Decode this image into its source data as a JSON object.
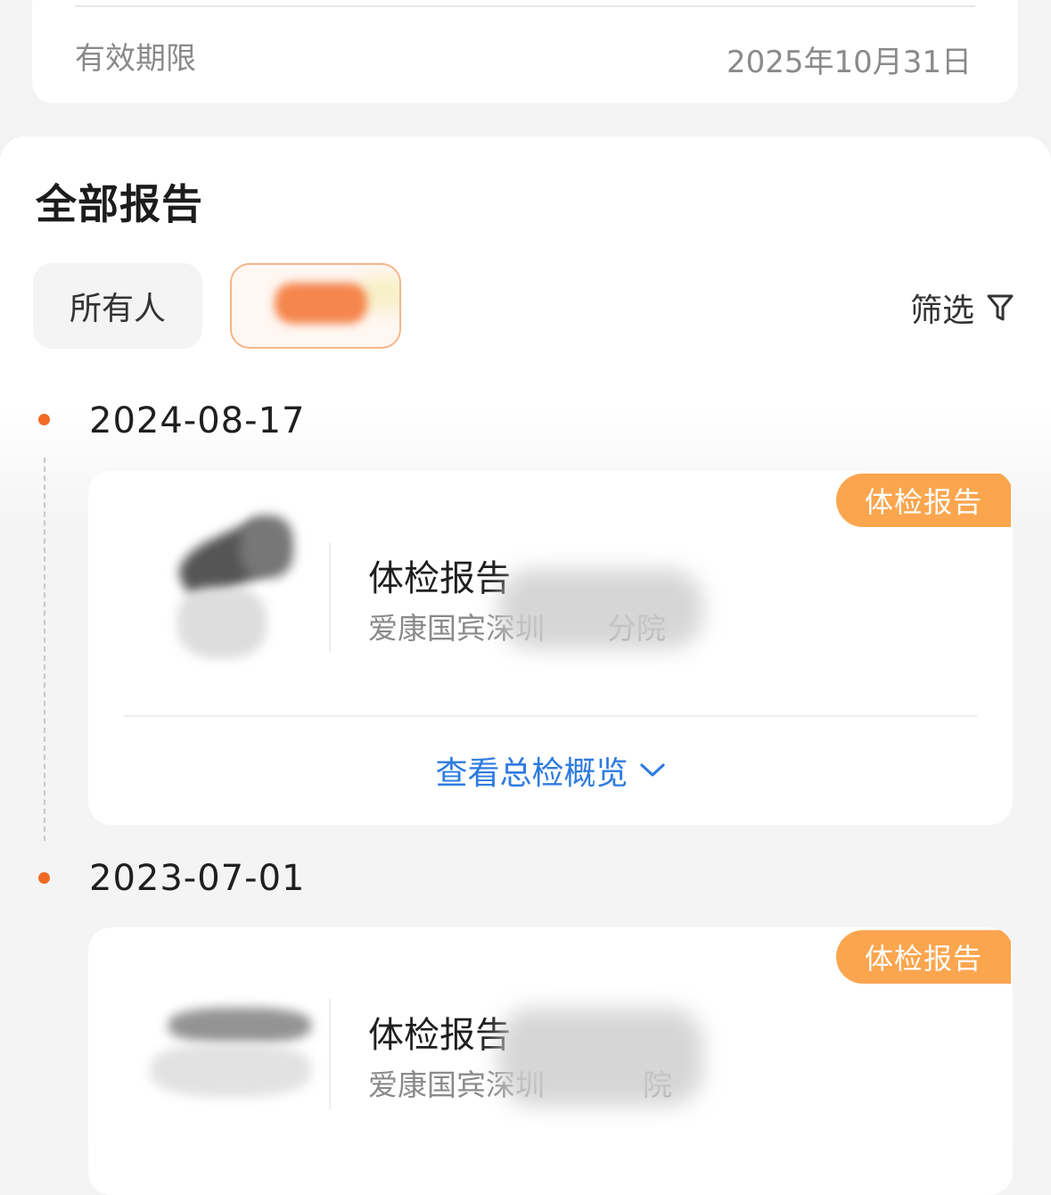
{
  "validity": {
    "label": "有效期限",
    "value": "2025年10月31日"
  },
  "section": {
    "title": "全部报告"
  },
  "filters": {
    "all_label": "所有人",
    "filter_label": "筛选",
    "filter_icon": "funnel-icon"
  },
  "reports": [
    {
      "date": "2024-08-17",
      "tag": "体检报告",
      "title": "体检报告",
      "hospital": "爱康国宾深圳",
      "hospital_suffix": "分院",
      "overview_label": "查看总检概览",
      "overview_icon": "chevron-down-icon"
    },
    {
      "date": "2023-07-01",
      "tag": "体检报告",
      "title": "体检报告",
      "hospital": "爱康国宾深圳",
      "hospital_suffix": "院"
    }
  ],
  "colors": {
    "accent_orange": "#f06a24",
    "tag_orange": "#fba64f",
    "link_blue": "#2d7be0"
  }
}
